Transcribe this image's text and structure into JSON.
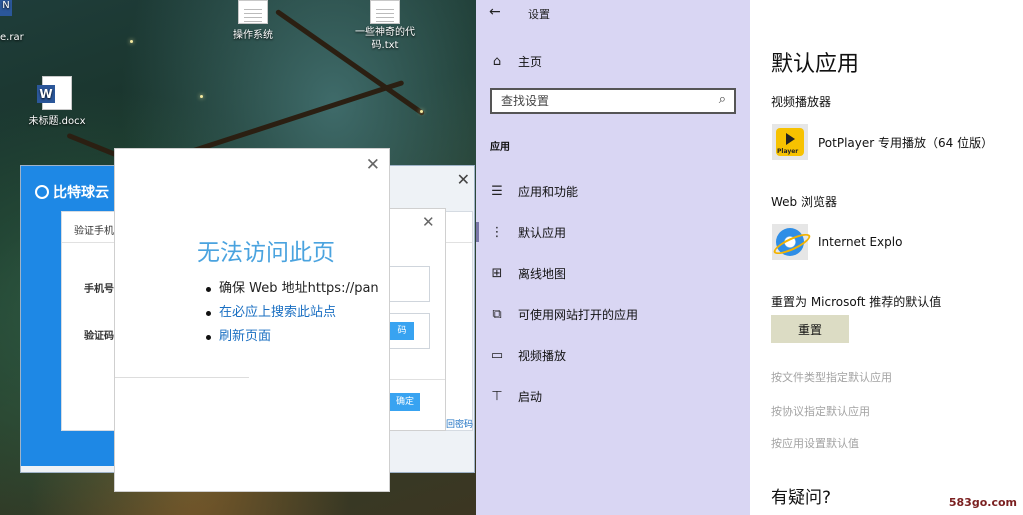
{
  "desktop": {
    "icons": [
      {
        "label": "操作系统"
      },
      {
        "label": "一些神奇的代码.txt"
      },
      {
        "label": "未标题.docx"
      }
    ],
    "partial_labels": {
      "rar": "e.rar",
      "top_left": "N"
    }
  },
  "bg_app": {
    "brand": "比特球云",
    "form_title": "验证手机",
    "phone_label": "手机号",
    "code_label": "验证码：",
    "get_code_btn": "码",
    "ok_btn": "确定",
    "get_pw_link": "回密码"
  },
  "error_dialog": {
    "title": "无法访问此页",
    "items": [
      {
        "text": "确保 Web 地址https://pan",
        "link": false
      },
      {
        "text": "在必应上搜索此站点",
        "link": true
      },
      {
        "text": "刷新页面",
        "link": true
      }
    ]
  },
  "settings": {
    "window_title": "设置",
    "home_label": "主页",
    "search_placeholder": "查找设置",
    "section_label": "应用",
    "nav_items": [
      {
        "label": "应用和功能",
        "icon": "list-icon"
      },
      {
        "label": "默认应用",
        "icon": "default-apps-icon",
        "selected": true
      },
      {
        "label": "离线地图",
        "icon": "map-icon"
      },
      {
        "label": "可使用网站打开的应用",
        "icon": "open-web-icon"
      },
      {
        "label": "视频播放",
        "icon": "video-icon"
      },
      {
        "label": "启动",
        "icon": "startup-icon"
      }
    ],
    "content": {
      "page_title": "默认应用",
      "video_player_head": "视频播放器",
      "video_player_app": "PotPlayer 专用播放（64 位版）",
      "web_browser_head": "Web 浏览器",
      "web_browser_app": "Internet Explo",
      "reset_head": "重置为 Microsoft 推荐的默认值",
      "reset_button": "重置",
      "links": [
        "按文件类型指定默认应用",
        "按协议指定默认应用",
        "按应用设置默认值"
      ],
      "help_head": "有疑问?"
    }
  },
  "watermark": "583go.com"
}
